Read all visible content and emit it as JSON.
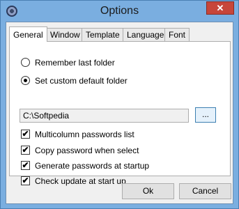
{
  "window": {
    "title": "Options",
    "close_label": "✕"
  },
  "tabs": [
    {
      "label": "General",
      "active": true
    },
    {
      "label": "Window"
    },
    {
      "label": "Template"
    },
    {
      "label": "Language"
    },
    {
      "label": "Font"
    }
  ],
  "general": {
    "remember_last_folder": {
      "label": "Remember last folder",
      "checked": false
    },
    "set_custom_folder": {
      "label": "Set custom default folder",
      "checked": true
    },
    "folder_path": "C:\\Softpedia",
    "browse_label": "...",
    "multicolumn": {
      "label": "Multicolumn passwords list",
      "checked": true
    },
    "copy_password": {
      "label": "Copy password when select",
      "checked": true
    },
    "generate_startup": {
      "label": "Generate passwords at startup",
      "checked": true
    },
    "check_update": {
      "label": "Check update at start up",
      "checked": true
    },
    "check_mark": "✔"
  },
  "buttons": {
    "ok": "Ok",
    "cancel": "Cancel"
  }
}
